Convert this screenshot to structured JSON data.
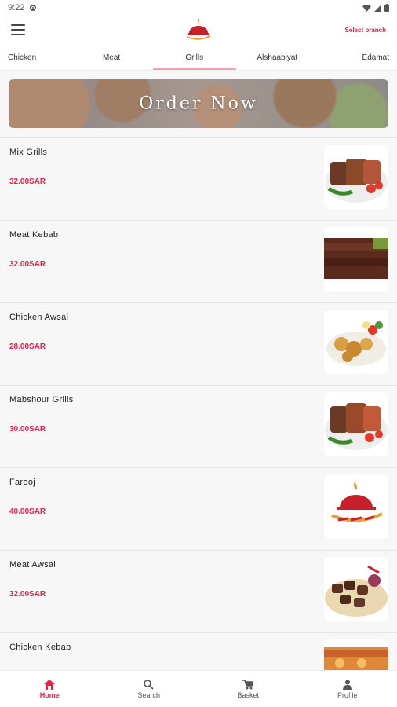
{
  "status_bar": {
    "time": "9:22"
  },
  "header": {
    "select_branch": "Select branch"
  },
  "tabs": [
    {
      "label": "Chicken"
    },
    {
      "label": "Meat"
    },
    {
      "label": "Grills",
      "active": true
    },
    {
      "label": "Alshaabiyat"
    },
    {
      "label": "Edamat"
    }
  ],
  "banner": {
    "text": "Order Now"
  },
  "items": [
    {
      "name": "Mix Grills",
      "price": "32.00SAR",
      "image": "mixed-grill-plate"
    },
    {
      "name": "Meat Kebab",
      "price": "32.00SAR",
      "image": "meat-kebab"
    },
    {
      "name": "Chicken Awsal",
      "price": "28.00SAR",
      "image": "chicken-pieces"
    },
    {
      "name": "Mabshour Grills",
      "price": "30.00SAR",
      "image": "mixed-grill-plate"
    },
    {
      "name": "Farooj",
      "price": "40.00SAR",
      "image": "restaurant-logo"
    },
    {
      "name": "Meat Awsal",
      "price": "32.00SAR",
      "image": "meat-cubes"
    },
    {
      "name": "Chicken Kebab",
      "price": "",
      "image": "chicken-kebab"
    }
  ],
  "bottom_nav": [
    {
      "label": "Home",
      "icon": "home-icon",
      "active": true
    },
    {
      "label": "Search",
      "icon": "search-icon"
    },
    {
      "label": "Basket",
      "icon": "cart-icon"
    },
    {
      "label": "Profile",
      "icon": "person-icon"
    }
  ],
  "colors": {
    "accent": "#e8204a",
    "tab_indicator": "#f2a3b0"
  }
}
